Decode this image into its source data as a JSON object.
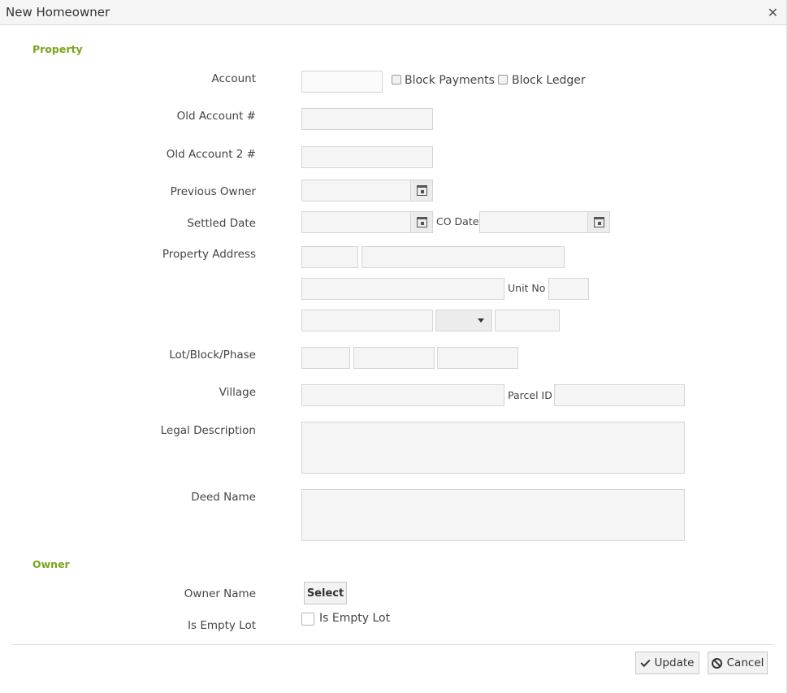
{
  "dialog": {
    "title": "New Homeowner",
    "close_icon": "close-icon"
  },
  "property": {
    "section_title": "Property",
    "account_label": "Account",
    "block_payments_label": "Block Payments",
    "block_ledger_label": "Block Ledger",
    "old_account_label": "Old Account #",
    "old_account2_label": "Old Account 2 #",
    "previous_owner_label": "Previous Owner",
    "settled_date_label": "Settled Date",
    "co_date_label": "CO Date",
    "property_address_label": "Property Address",
    "unit_no_label": "Unit No",
    "lot_block_phase_label": "Lot/Block/Phase",
    "village_label": "Village",
    "parcel_id_label": "Parcel ID",
    "legal_description_label": "Legal Description",
    "deed_name_label": "Deed Name"
  },
  "owner": {
    "section_title": "Owner",
    "owner_name_label": "Owner Name",
    "select_button": "Select",
    "is_empty_lot_label": "Is Empty Lot",
    "is_empty_lot_checkbox_label": "Is Empty Lot"
  },
  "footer": {
    "update_button": "Update",
    "cancel_button": "Cancel"
  }
}
